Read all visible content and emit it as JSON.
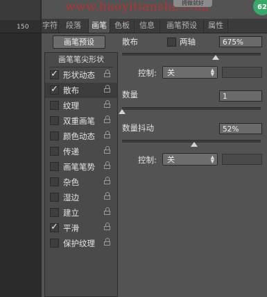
{
  "watermark": "www.haoyitianshe.com",
  "top_button": "拥做就好",
  "badge": "62",
  "ruler_label": "150",
  "tabs": [
    "字符",
    "段落",
    "画笔",
    "色板",
    "信息",
    "画笔预设",
    "属性"
  ],
  "active_tab": "画笔",
  "preset_button": "画笔预设",
  "tip_shape_header": "画笔笔尖形状",
  "options": [
    {
      "label": "形状动态",
      "checked": true
    },
    {
      "label": "散布",
      "checked": true,
      "selected": true
    },
    {
      "label": "纹理",
      "checked": false
    },
    {
      "label": "双重画笔",
      "checked": false
    },
    {
      "label": "颜色动态",
      "checked": false
    },
    {
      "label": "传递",
      "checked": false
    },
    {
      "label": "画笔笔势",
      "checked": false
    },
    {
      "label": "杂色",
      "checked": false
    },
    {
      "label": "湿边",
      "checked": false
    },
    {
      "label": "建立",
      "checked": false
    },
    {
      "label": "平滑",
      "checked": true
    },
    {
      "label": "保护纹理",
      "checked": false
    }
  ],
  "scatter": {
    "label": "散布",
    "both_axes_label": "两轴",
    "both_axes_checked": false,
    "value": "675%",
    "control_label": "控制:",
    "control_value": "关"
  },
  "count": {
    "label": "数量",
    "value": "1"
  },
  "count_jitter": {
    "label": "数量抖动",
    "value": "52%",
    "control_label": "控制:",
    "control_value": "关"
  },
  "sliders": {
    "scatter": 0.675,
    "count": 0.0,
    "count_jitter": 0.52
  }
}
